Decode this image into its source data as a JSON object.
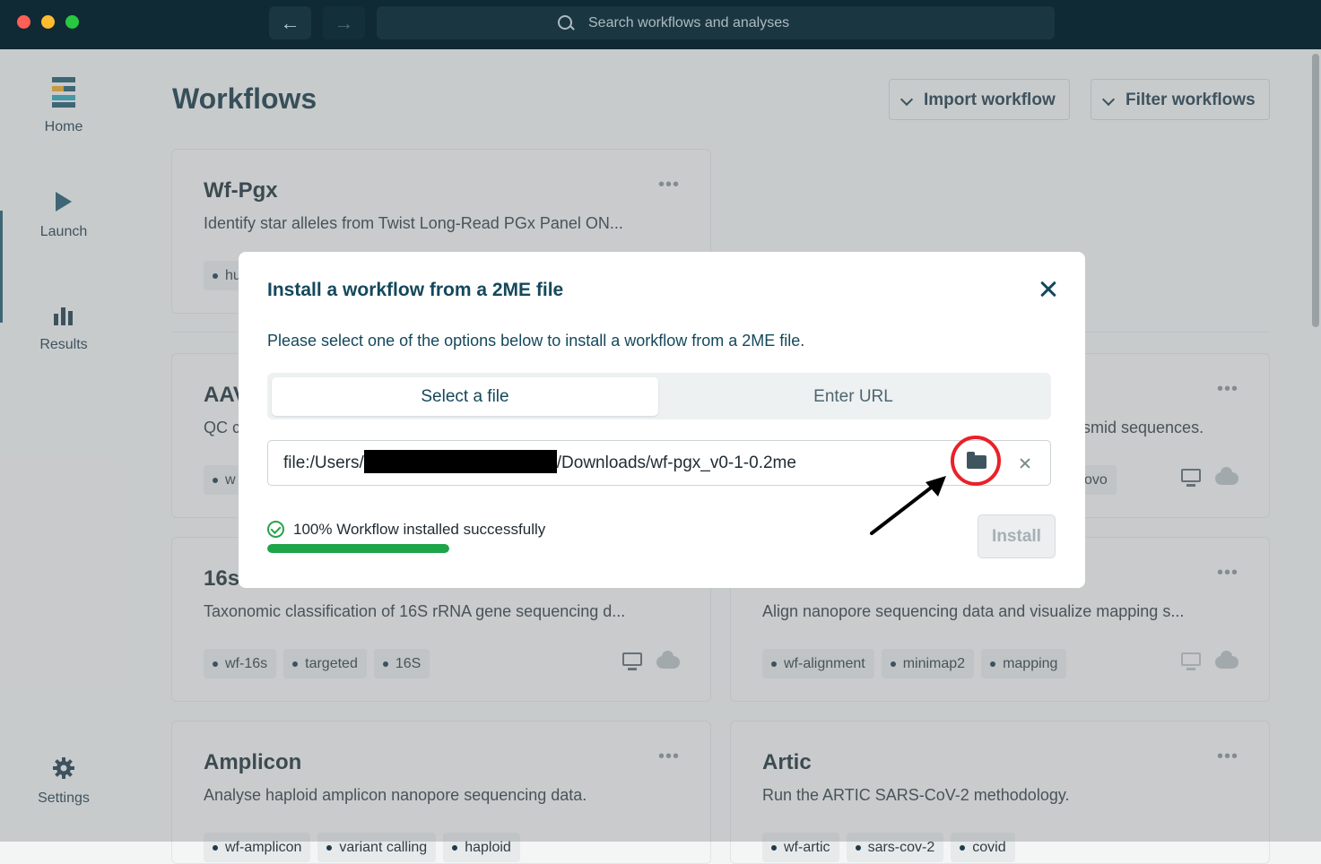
{
  "titlebar": {
    "search_placeholder": "Search workflows and analyses"
  },
  "sidebar": {
    "items": [
      {
        "label": "Home",
        "icon": "logo-bars-icon"
      },
      {
        "label": "Launch",
        "icon": "play-icon"
      },
      {
        "label": "Results",
        "icon": "bar-chart-icon"
      },
      {
        "label": "Settings",
        "icon": "gear-icon"
      }
    ],
    "active_index": 1
  },
  "main": {
    "title": "Workflows",
    "import_label": "Import workflow",
    "filter_label": "Filter workflows"
  },
  "cards": [
    {
      "title": "Wf-Pgx",
      "desc": "Identify star alleles from Twist Long-Read PGx Panel ON...",
      "tags": [
        "hu"
      ]
    },
    {
      "title": "AAV",
      "desc": "QC c",
      "tags": [
        "w"
      ]
    },
    {
      "title": "",
      "desc": "smid sequences.",
      "tags": [
        "ovo"
      ]
    },
    {
      "title": "16s",
      "desc": "Taxonomic classification of 16S rRNA gene sequencing d...",
      "tags": [
        "wf-16s",
        "targeted",
        "16S"
      ]
    },
    {
      "title": "",
      "desc": "Align nanopore sequencing data and visualize mapping s...",
      "tags": [
        "wf-alignment",
        "minimap2",
        "mapping"
      ]
    },
    {
      "title": "Amplicon",
      "desc": "Analyse haploid amplicon nanopore sequencing data.",
      "tags": [
        "wf-amplicon",
        "variant calling",
        "haploid"
      ]
    },
    {
      "title": "Artic",
      "desc": "Run the ARTIC SARS-CoV-2 methodology.",
      "tags": [
        "wf-artic",
        "sars-cov-2",
        "covid"
      ]
    }
  ],
  "card_menu_glyph": "•••",
  "modal": {
    "title": "Install a workflow from a 2ME file",
    "subtitle": "Please select one of the options below to install a workflow from a 2ME file.",
    "tabs": [
      "Select a file",
      "Enter URL"
    ],
    "active_tab": 0,
    "file_path_prefix": "file:/Users/",
    "file_path_suffix": "/Downloads/wf-pgx_v0-1-0.2me",
    "status_text": "100% Workflow installed successfully",
    "progress": 1.0,
    "install_label": "Install"
  },
  "colors": {
    "titlebar": "#0f2a34",
    "accent": "#14485c",
    "success": "#1ea449",
    "highlight_ring": "#ea2127"
  }
}
